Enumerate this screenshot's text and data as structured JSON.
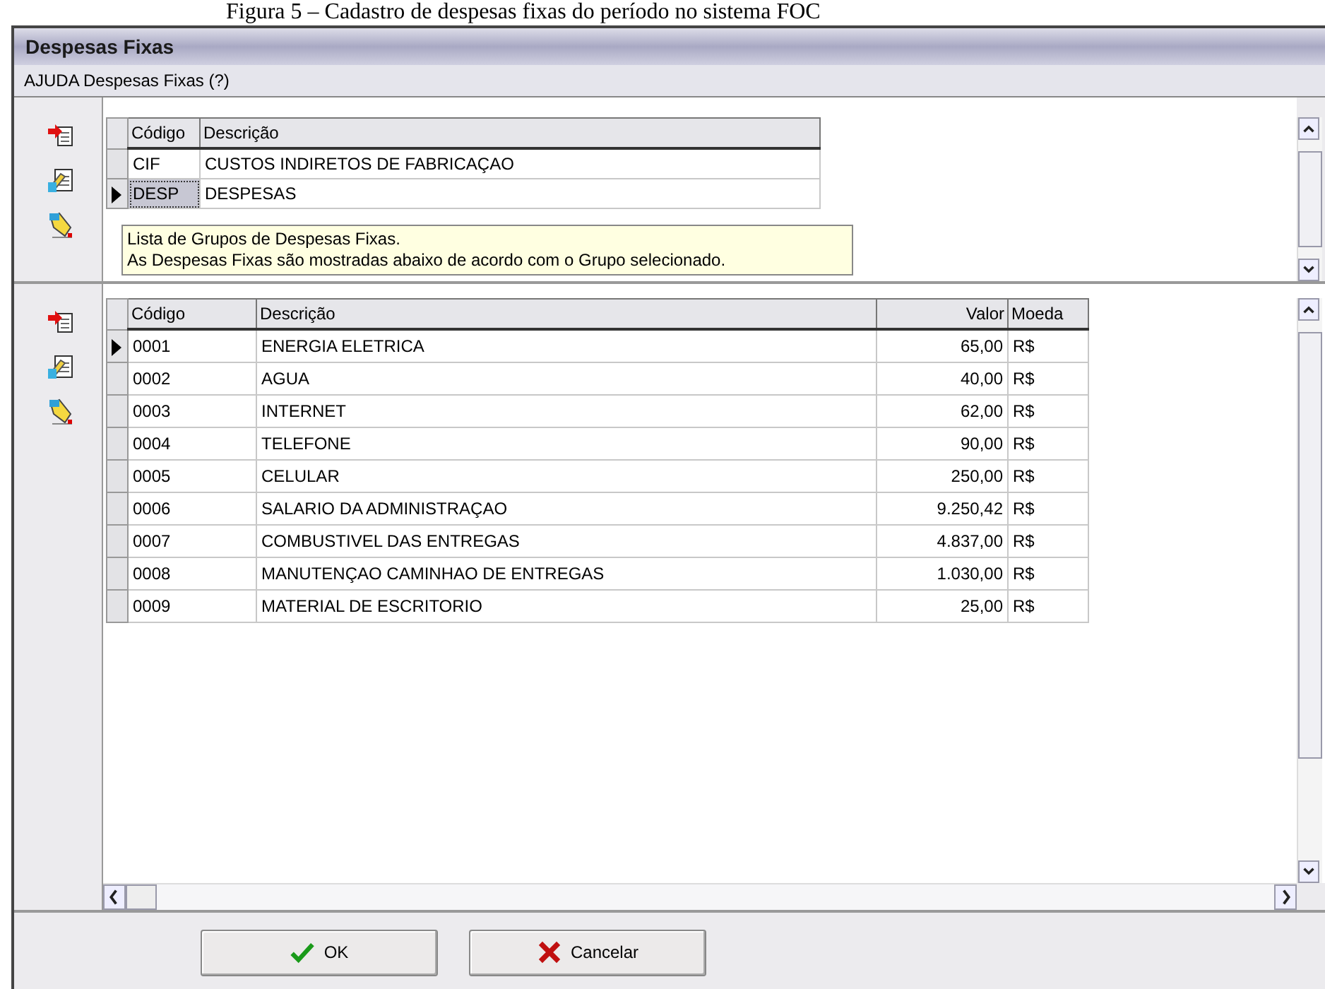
{
  "caption": "Figura 5 – Cadastro de despesas fixas do período no sistema FOC",
  "window": {
    "title": "Despesas Fixas"
  },
  "help_link": "AJUDA Despesas Fixas (?)",
  "groups": {
    "columns": [
      "Código",
      "Descrição"
    ],
    "rows": [
      {
        "code": "CIF",
        "description": "CUSTOS INDIRETOS DE FABRICAÇAO",
        "selected": false
      },
      {
        "code": "DESP",
        "description": "DESPESAS",
        "selected": true
      }
    ]
  },
  "tooltip": [
    "Lista de Grupos de Despesas Fixas.",
    "As Despesas Fixas são mostradas abaixo de acordo com o Grupo selecionado."
  ],
  "expenses": {
    "columns": [
      "Código",
      "Descrição",
      "Valor",
      "Moeda"
    ],
    "rows": [
      {
        "code": "0001",
        "description": "ENERGIA ELETRICA",
        "value": "65,00",
        "currency": "R$",
        "selected": true
      },
      {
        "code": "0002",
        "description": "AGUA",
        "value": "40,00",
        "currency": "R$",
        "selected": false
      },
      {
        "code": "0003",
        "description": "INTERNET",
        "value": "62,00",
        "currency": "R$",
        "selected": false
      },
      {
        "code": "0004",
        "description": "TELEFONE",
        "value": "90,00",
        "currency": "R$",
        "selected": false
      },
      {
        "code": "0005",
        "description": "CELULAR",
        "value": "250,00",
        "currency": "R$",
        "selected": false
      },
      {
        "code": "0006",
        "description": "SALARIO DA ADMINISTRAÇAO",
        "value": "9.250,42",
        "currency": "R$",
        "selected": false
      },
      {
        "code": "0007",
        "description": "COMBUSTIVEL DAS ENTREGAS",
        "value": "4.837,00",
        "currency": "R$",
        "selected": false
      },
      {
        "code": "0008",
        "description": "MANUTENÇAO CAMINHAO DE ENTREGAS",
        "value": "1.030,00",
        "currency": "R$",
        "selected": false
      },
      {
        "code": "0009",
        "description": "MATERIAL DE ESCRITORIO",
        "value": "25,00",
        "currency": "R$",
        "selected": false
      }
    ]
  },
  "buttons": [
    {
      "label": "OK",
      "kind": "ok"
    },
    {
      "label": "Cancelar",
      "kind": "cancel"
    }
  ]
}
